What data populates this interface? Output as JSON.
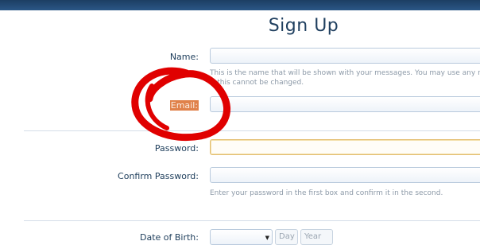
{
  "page": {
    "title": "Sign Up"
  },
  "form": {
    "name": {
      "label": "Name:",
      "value": "",
      "hint_line1": "This is the name that will be shown with your messages. You may use any na",
      "hint_line2": "t, this cannot be changed."
    },
    "email": {
      "label": "Email:",
      "value": ""
    },
    "password": {
      "label": "Password:",
      "value": ""
    },
    "confirm_password": {
      "label": "Confirm Password:",
      "value": "",
      "hint": "Enter your password in the first box and confirm it in the second."
    },
    "date_of_birth": {
      "label": "Date of Birth:",
      "month_value": "",
      "day_placeholder": "Day",
      "year_placeholder": "Year"
    }
  },
  "annotation": {
    "color": "#e00000",
    "shape": "hand-drawn circle around email label"
  },
  "colors": {
    "header_bar": "#1c3e63",
    "title": "#1f3f5f",
    "label": "#1c3c5a",
    "highlight": "#e0814a",
    "focus_border": "#e3be70"
  }
}
